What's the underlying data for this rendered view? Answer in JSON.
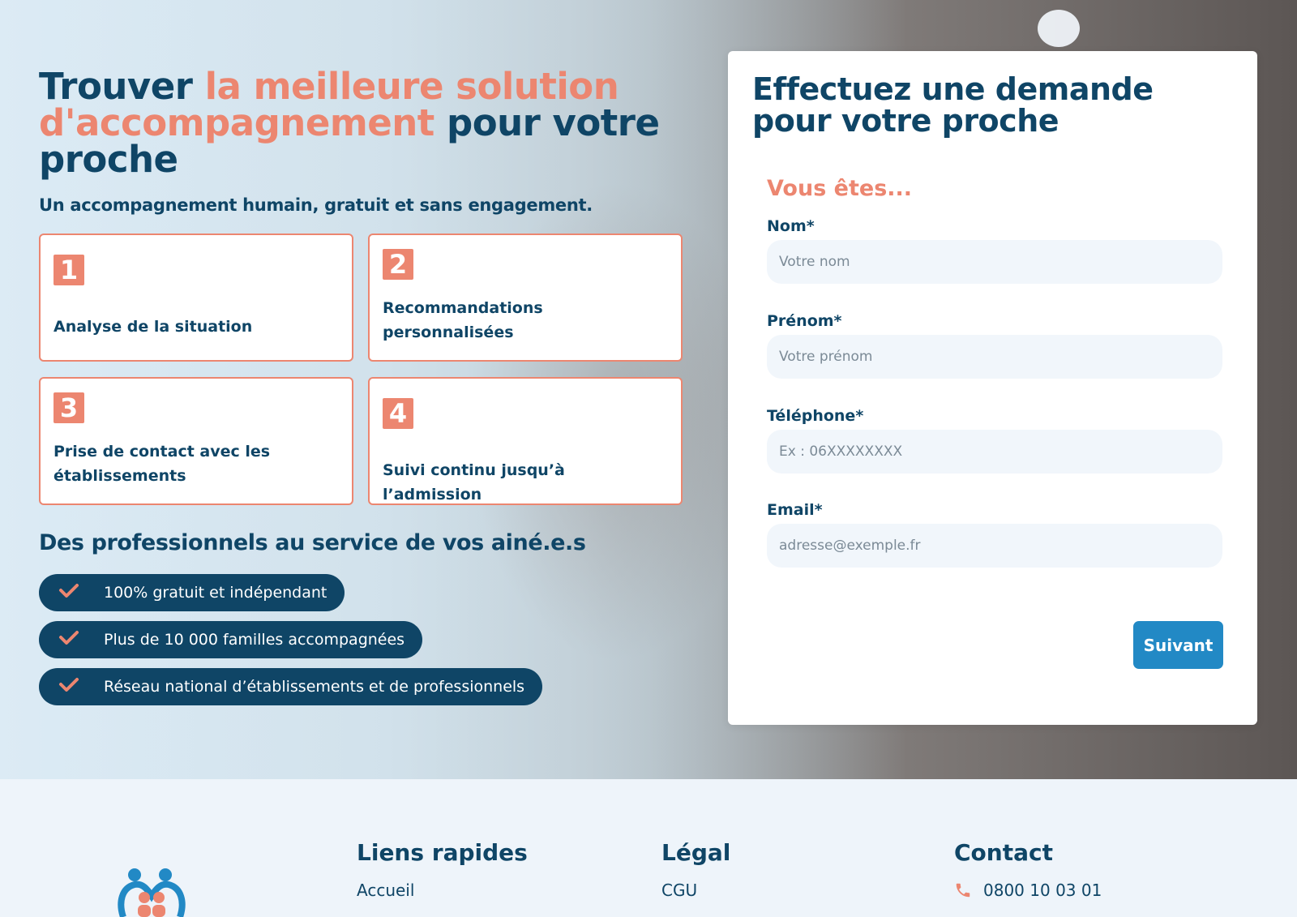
{
  "hero": {
    "title_part1": "Trouver ",
    "title_accent": "la meilleure solution d'accompagnement",
    "title_part2": " pour votre proche",
    "subtitle": "Un accompagnement humain, gratuit et sans engagement."
  },
  "steps": [
    {
      "number": "1",
      "label": "Analyse de la situation"
    },
    {
      "number": "2",
      "label": "Recommandations personnalisées"
    },
    {
      "number": "3",
      "label": "Prise de contact avec les établissements"
    },
    {
      "number": "4",
      "label": "Suivi continu jusqu’à l’admission"
    }
  ],
  "pros": {
    "title": "Des professionnels au service de vos ainé.e.s",
    "items": [
      "100% gratuit et indépendant",
      "Plus de 10 000 familles accompagnées",
      "Réseau national d’établissements et de professionnels"
    ]
  },
  "form": {
    "title": "Effectuez une demande pour votre proche",
    "subtitle": "Vous êtes...",
    "fields": [
      {
        "label": "Nom*",
        "placeholder": "Votre nom"
      },
      {
        "label": "Prénom*",
        "placeholder": "Votre prénom"
      },
      {
        "label": "Téléphone*",
        "placeholder": "Ex : 06XXXXXXXX"
      },
      {
        "label": "Email*",
        "placeholder": "adresse@exemple.fr"
      }
    ],
    "submit_label": "Suivant"
  },
  "footer": {
    "quick_links_title": "Liens rapides",
    "quick_links": [
      "Accueil"
    ],
    "legal_title": "Légal",
    "legal_links": [
      "CGU"
    ],
    "contact_title": "Contact",
    "phone": "0800 10 03 01"
  },
  "colors": {
    "navy": "#0f4566",
    "accent": "#ec8670",
    "button": "#2289c5",
    "field_bg": "#f1f6fb"
  },
  "icons": {
    "check": "check-icon",
    "phone": "phone-icon",
    "logo": "family-heart-logo"
  }
}
